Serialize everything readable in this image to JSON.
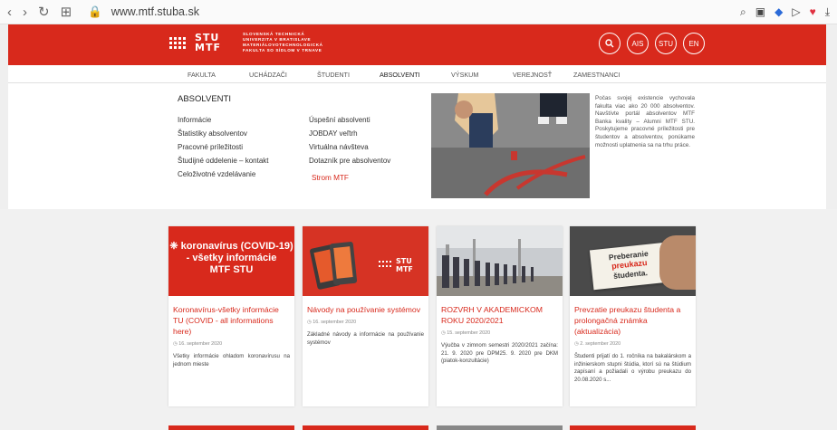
{
  "browser": {
    "url": "www.mtf.stuba.sk"
  },
  "header": {
    "logo_main": "STU",
    "logo_sub": "MTF",
    "school_lines": [
      "SLOVENSKÁ TECHNICKÁ",
      "UNIVERZITA V BRATISLAVE",
      "MATERIÁLOVOTECHNOLOGICKÁ",
      "FAKULTA SO SÍDLOM V TRNAVE"
    ],
    "circle_buttons": [
      "AIS",
      "STU",
      "EN"
    ]
  },
  "topmenu": [
    "FAKULTA",
    "UCHÁDZAČI",
    "ŠTUDENTI",
    "ABSOLVENTI",
    "VÝSKUM",
    "VEREJNOSŤ",
    "ZAMESTNANCI"
  ],
  "dropdown": {
    "title": "ABSOLVENTI",
    "col1": [
      "Informácie",
      "Štatistiky absolventov",
      "Pracovné príležitosti",
      "Študijné oddelenie – kontakt",
      "Celoživotné vzdelávanie"
    ],
    "col2": [
      "Úspešní absolventi",
      "JOBDAY veľtrh",
      "Virtuálna návšteva",
      "Dotazník pre absolventov"
    ],
    "col2_red": "Strom MTF",
    "blurb": "Počas svojej existencie vychovala fakulta viac ako 20 000 absolventov. Navštívte portál absolventov MTF Banka kvality – Alumni MTF STU. Poskytujeme pracovné príležitosti pre študentov a absolventov, ponúkame možnosti uplatnenia sa na trhu práce."
  },
  "cards": [
    {
      "thumb_line1": "koronavírus (COVID-19)",
      "thumb_line2": "- všetky informácie",
      "thumb_line3": "MTF STU",
      "title": "Koronavírus-všetky informácie TU (COVID - all informations here)",
      "date": "16. september 2020",
      "text": "Všetky informácie ohladom koronavírusu na jednom mieste"
    },
    {
      "title": "Návody na používanie systémov",
      "date": "16. september 2020",
      "text": "Základné návody a informácie na používanie systémov"
    },
    {
      "title": "ROZVRH V AKADEMICKOM ROKU 2020/2021",
      "date": "15. september 2020",
      "text": "Výučba v zimnom semestri 2020/2021 začína: 21. 9. 2020 pre DPM25. 9. 2020 pre DKM (piatok-konzultácie)"
    },
    {
      "thumb_line1": "Preberanie",
      "thumb_line2": "preukazu",
      "thumb_line3": "študenta.",
      "title": "Prevzatie preukazu študenta a prolongačná známka (aktualizácia)",
      "date": "2. september 2020",
      "text": "Študenti prijatí do 1. ročníka na bakalárskom a inžinierskom stupni štúdia, ktorí sú na štúdium zapísaní a požiadali o výrobu preukazu do 20.08.2020 s..."
    }
  ]
}
